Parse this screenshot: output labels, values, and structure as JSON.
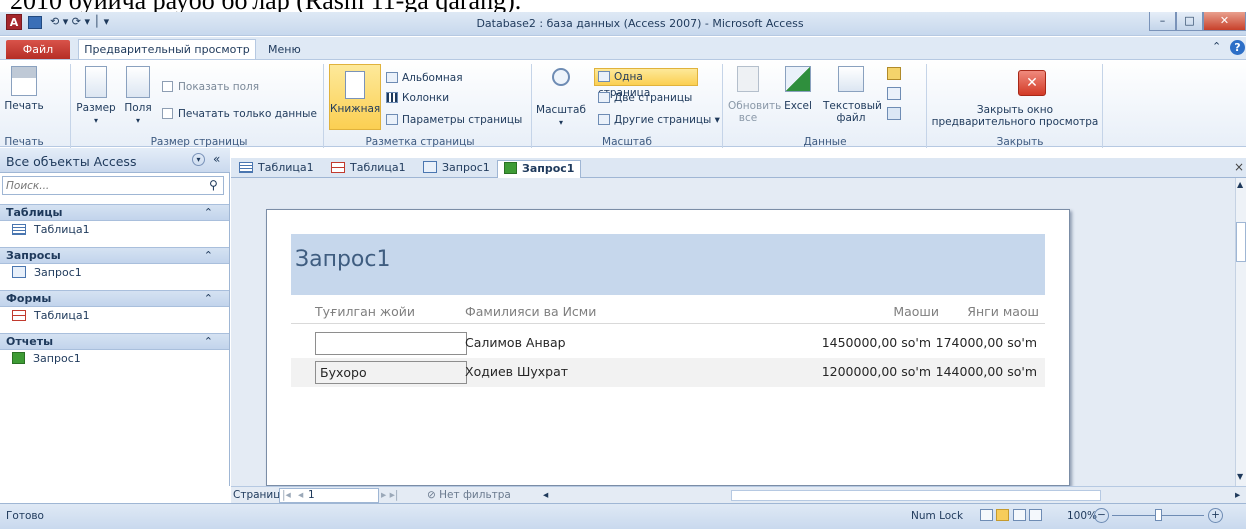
{
  "overlay_text": "2010 буйича раубо бо'лар (Rasm 11-ga qarang).",
  "window": {
    "title": "Database2 : база данных (Access 2007)  -  Microsoft Access",
    "app_icon_letter": "A",
    "qat": "⟲ ▾  ⟳ ▾ │ ▾",
    "minimize": "–",
    "maximize": "□",
    "close": "✕"
  },
  "ribbon_tabs": {
    "file": "Файл",
    "preview": "Предварительный просмотр",
    "menu": "Меню",
    "collapse": "⌃",
    "help": "?"
  },
  "ribbon": {
    "print_group": {
      "label": "Печать",
      "print": "Печать"
    },
    "page_size_group": {
      "label": "Размер страницы",
      "size": "Размер",
      "margins": "Поля",
      "show_margins": "Показать поля",
      "print_data_only": "Печатать только данные"
    },
    "page_layout_group": {
      "label": "Разметка страницы",
      "portrait": "Книжная",
      "landscape": "Альбомная",
      "columns": "Колонки",
      "page_setup": "Параметры страницы"
    },
    "zoom_group": {
      "label": "Масштаб",
      "zoom": "Масштаб",
      "one_page": "Одна страница",
      "two_pages": "Две страницы",
      "more_pages": "Другие страницы"
    },
    "data_group": {
      "label": "Данные",
      "refresh_all": "Обновить все",
      "excel": "Excel",
      "text_file": "Текстовый файл"
    },
    "close_group": {
      "label": "Закрыть",
      "close_preview": "Закрыть окно предварительного просмотра"
    }
  },
  "nav_pane": {
    "header": "Все объекты Access",
    "search_placeholder": "Поиск...",
    "groups": [
      {
        "label": "Таблицы",
        "items": [
          "Таблица1"
        ]
      },
      {
        "label": "Запросы",
        "items": [
          "Запрос1"
        ]
      },
      {
        "label": "Формы",
        "items": [
          "Таблица1"
        ]
      },
      {
        "label": "Отчеты",
        "items": [
          "Запрос1"
        ]
      }
    ]
  },
  "doc_tabs": [
    "Таблица1",
    "Таблица1",
    "Запрос1",
    "Запрос1"
  ],
  "report": {
    "title": "Запрос1",
    "headers": [
      "Туғилган жойи",
      "Фамилияси ва Исми",
      "Маоши",
      "Янги маош"
    ],
    "rows": [
      {
        "place": "",
        "name": "Салимов Анвар",
        "salary": "1450000,00 so'm",
        "new_salary": "174000,00 so'm"
      },
      {
        "place": "Бухоро",
        "name": "Ходиев Шухрат",
        "salary": "1200000,00 so'm",
        "new_salary": "144000,00 so'm"
      }
    ]
  },
  "record_nav": {
    "label": "Страница:",
    "current": "1",
    "filter": "Нет фильтра"
  },
  "status": {
    "ready": "Готово",
    "num_lock": "Num Lock",
    "zoom": "100%"
  }
}
